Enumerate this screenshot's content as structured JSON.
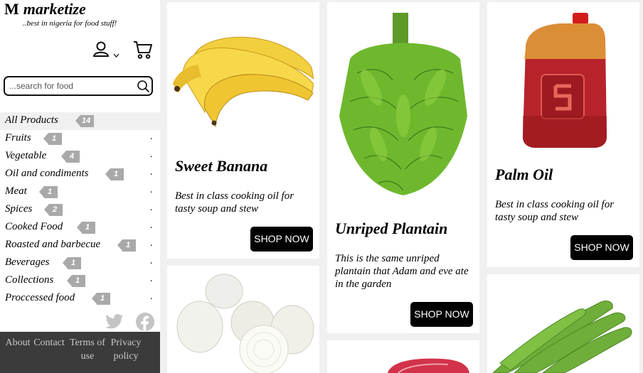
{
  "brand": {
    "logo_letter": "M",
    "name": "marketize",
    "tagline": "..best in nigeria for food stuff!"
  },
  "header": {
    "icons": [
      "user-icon",
      "chevron-down-icon",
      "cart-icon"
    ]
  },
  "search": {
    "placeholder": "...search for food"
  },
  "categories": [
    {
      "label": "All Products",
      "count": "14"
    },
    {
      "label": "Fruits",
      "count": "1"
    },
    {
      "label": "Vegetable",
      "count": "4"
    },
    {
      "label": "Oil and condiments",
      "count": "1"
    },
    {
      "label": "Meat",
      "count": "1"
    },
    {
      "label": "Spices",
      "count": "2"
    },
    {
      "label": "Cooked Food",
      "count": "1"
    },
    {
      "label": "Roasted and barbecue",
      "count": "1"
    },
    {
      "label": "Beverages",
      "count": "1"
    },
    {
      "label": "Collections",
      "count": "1"
    },
    {
      "label": "Proccessed food",
      "count": "1"
    }
  ],
  "category_dot": ".",
  "social": [
    "twitter-icon",
    "facebook-icon"
  ],
  "footer": {
    "about": "About",
    "contact": "Contact",
    "terms": "Terms of use",
    "privacy": "Privacy policy"
  },
  "products": [
    {
      "title": "Sweet Banana",
      "description": "Best in class cooking oil for tasty soup and stew",
      "button": "SHOP NOW"
    },
    {
      "title": "Unriped Plantain",
      "description": "This is the same unriped plantain that Adam and eve ate in the garden",
      "button": "SHOP NOW"
    },
    {
      "title": "Palm Oil",
      "description": "Best in class cooking oil for tasty soup and stew",
      "button": "SHOP NOW"
    }
  ]
}
